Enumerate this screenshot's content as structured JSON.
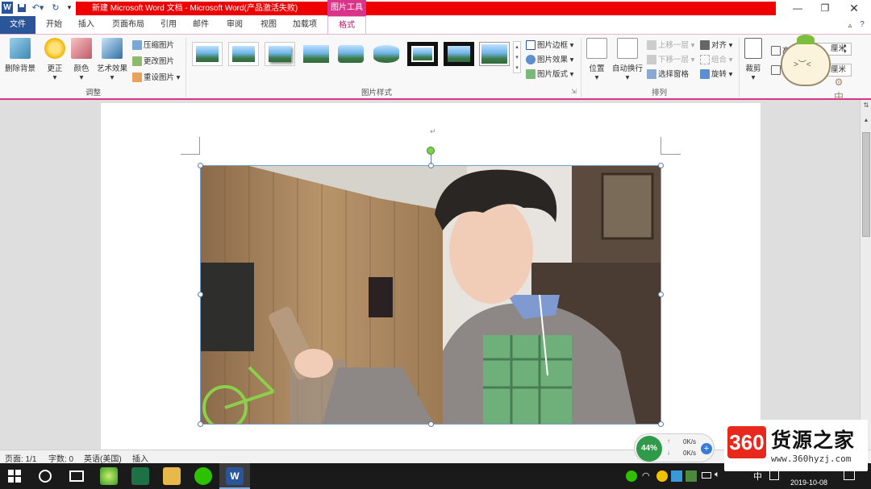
{
  "window": {
    "title": "新建 Microsoft Word 文档 - Microsoft Word(产品激活失败)",
    "context_tab": "图片工具"
  },
  "tabs": [
    {
      "label": "文件"
    },
    {
      "label": "开始"
    },
    {
      "label": "插入"
    },
    {
      "label": "页面布局"
    },
    {
      "label": "引用"
    },
    {
      "label": "邮件"
    },
    {
      "label": "审阅"
    },
    {
      "label": "视图"
    },
    {
      "label": "加载项"
    },
    {
      "label": "格式"
    }
  ],
  "ribbon": {
    "adjust": {
      "remove_bg": "删除背景",
      "correct": "更正",
      "color": "颜色",
      "art": "艺术效果",
      "compress": "压缩图片",
      "change": "更改图片",
      "reset": "重设图片",
      "group": "调整"
    },
    "styles": {
      "border": "图片边框",
      "effects": "图片效果",
      "layout": "图片版式",
      "group": "图片样式"
    },
    "arrange": {
      "position": "位置",
      "wrap": "自动换行",
      "bring_forward": "上移一层",
      "send_backward": "下移一层",
      "selection_pane": "选择窗格",
      "align": "对齐",
      "group_btn": "组合",
      "rotate": "旋转",
      "group": "排列"
    },
    "size": {
      "crop": "裁剪",
      "height_label": "高度:",
      "height_unit": "厘米",
      "width_unit": "厘米"
    }
  },
  "status": {
    "page": "页面: 1/1",
    "words": "字数: 0",
    "lang": "英语(美国)",
    "mode": "插入"
  },
  "network": {
    "percent": "44%",
    "up": "0K/s",
    "down": "0K/s"
  },
  "taskbar": {
    "ime": "中",
    "date": "2019-10-08"
  },
  "watermark": {
    "logo": "360",
    "name": "货源之家",
    "url": "www.360hyzj.com"
  },
  "colors": {
    "accent": "#2a5699",
    "context": "#d9348a",
    "title_red": "#ee0000"
  }
}
